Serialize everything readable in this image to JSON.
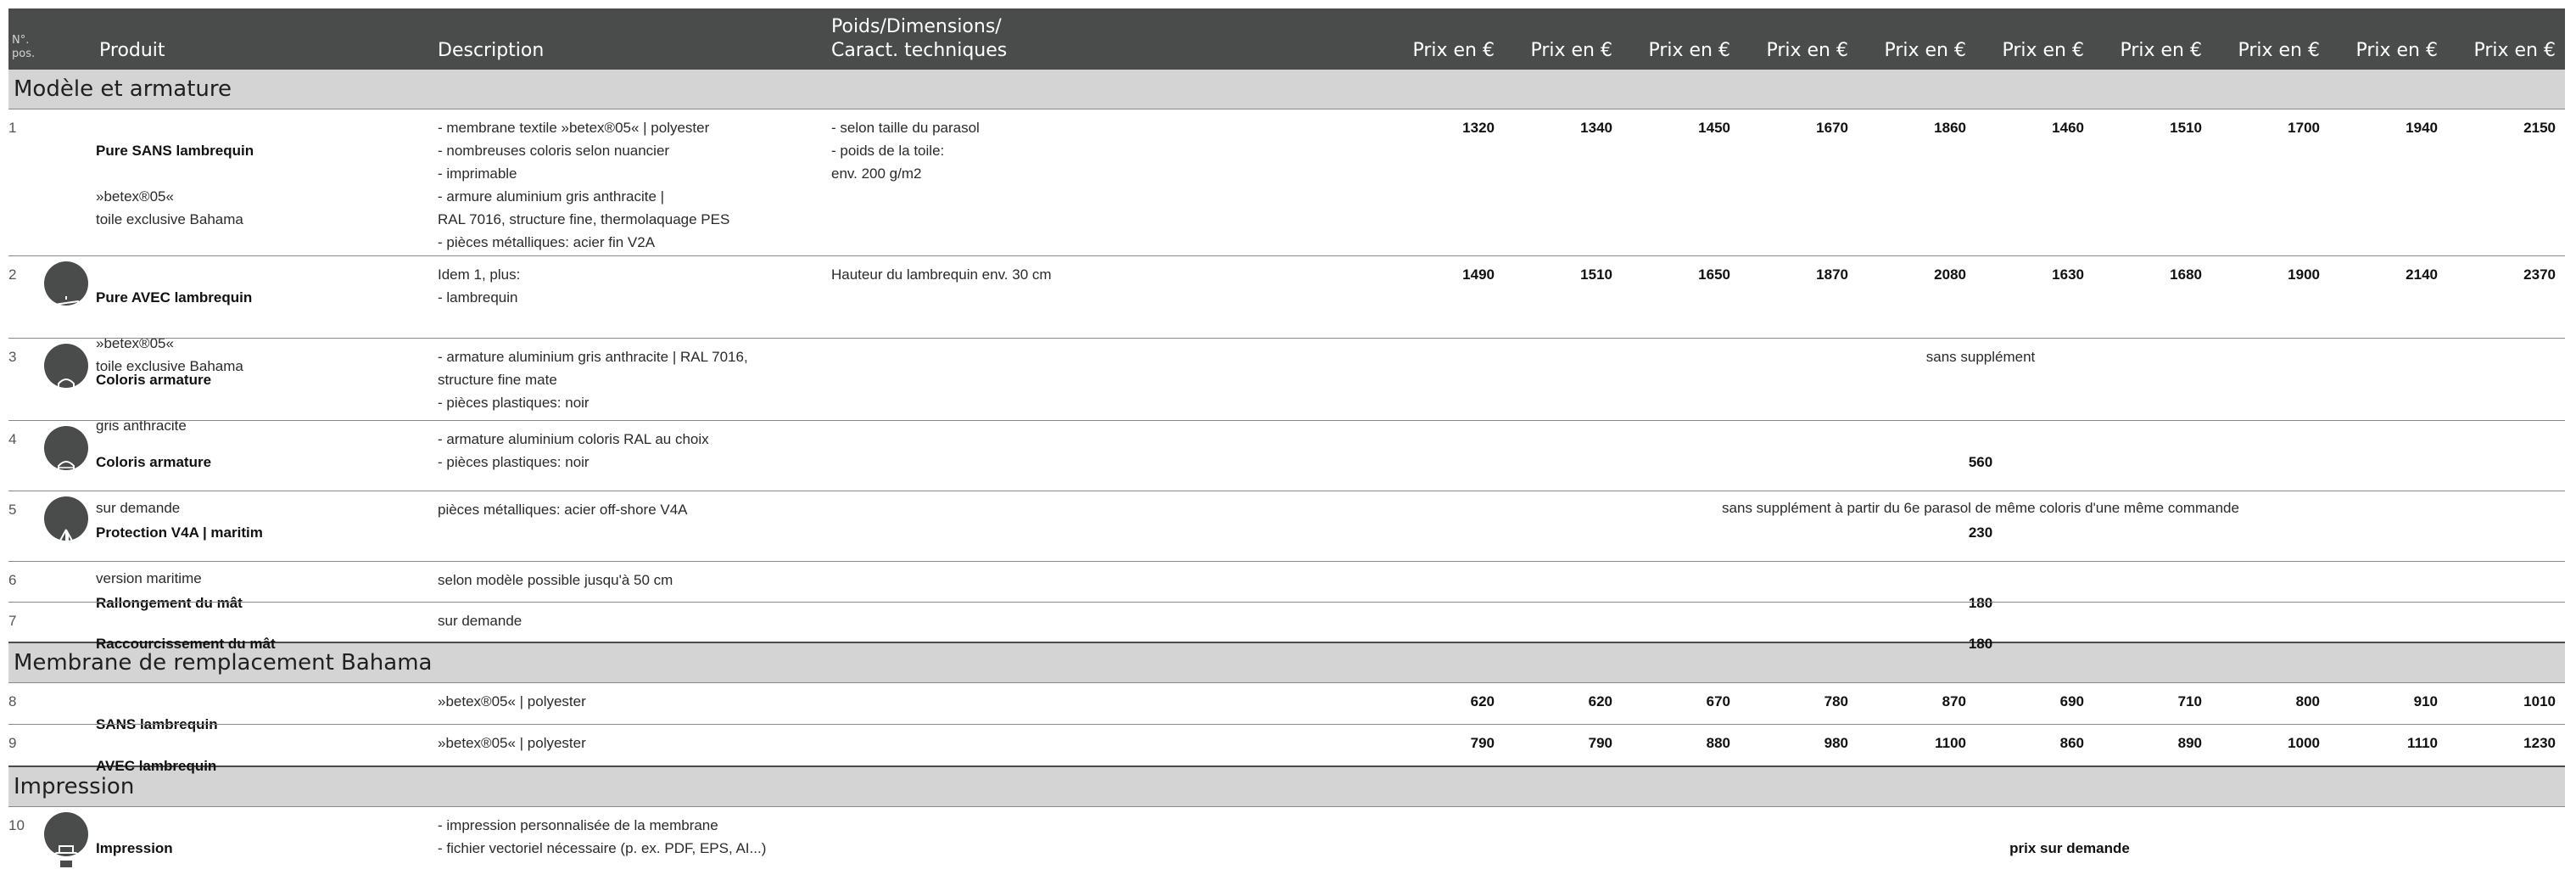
{
  "header": {
    "pos": "N°.\npos.",
    "produit": "Produit",
    "description": "Description",
    "poids": "Poids/Dimensions/\nCaract. techniques",
    "prices": [
      "Prix en €",
      "Prix en €",
      "Prix en €",
      "Prix en €",
      "Prix en €",
      "Prix en €",
      "Prix en €",
      "Prix en €",
      "Prix en €",
      "Prix en €"
    ]
  },
  "sections": {
    "modele": "Modèle et armature",
    "membrane": "Membrane de remplacement Bahama",
    "impression": "Impression"
  },
  "rows": [
    {
      "pos": "1",
      "icon": "",
      "name": "Pure SANS lambrequin",
      "sub": "»betex®05«\ntoile exclusive Bahama",
      "desc": "- membrane textile »betex®05« | polyester\n- nombreuses coloris selon nuancier\n- imprimable\n- armure aluminium gris anthracite |\n  RAL 7016, structure fine, thermolaquage PES\n- pièces métalliques: acier fin V2A",
      "poids": "- selon taille du parasol\n- poids de la toile:\n  env. 200 g/m2",
      "prices": [
        "1320",
        "1340",
        "1450",
        "1670",
        "1860",
        "1460",
        "1510",
        "1700",
        "1940",
        "2150"
      ]
    },
    {
      "pos": "2",
      "icon": "lambrequin-icon",
      "name": "Pure AVEC lambrequin",
      "sub": "»betex®05«\ntoile exclusive Bahama",
      "desc": "Idem 1, plus:\n- lambrequin",
      "poids": "Hauteur du lambrequin env. 30 cm",
      "prices": [
        "1490",
        "1510",
        "1650",
        "1870",
        "2080",
        "1630",
        "1680",
        "1900",
        "2140",
        "2370"
      ]
    },
    {
      "pos": "3",
      "icon": "frame-color-icon",
      "name": "Coloris armature",
      "sub": "gris anthracite",
      "desc": "- armature aluminium gris anthracite | RAL 7016,\n  structure fine mate\n- pièces plastiques: noir",
      "span": "sans supplément"
    },
    {
      "pos": "4",
      "icon": "frame-custom-color-icon",
      "name": "Coloris armature",
      "sub": "sur demande",
      "desc": "- armature aluminium coloris RAL au choix\n- pièces plastiques: noir",
      "span": "560",
      "span_note": "sans supplément à partir du 6e parasol de même coloris d'une même commande"
    },
    {
      "pos": "5",
      "icon": "sailboat-icon",
      "name": "Protection V4A | maritim",
      "sub": "version maritime",
      "desc": "pièces métalliques: acier off-shore V4A",
      "span": "230"
    },
    {
      "pos": "6",
      "name": "Rallongement du mât",
      "desc": "selon modèle possible jusqu'à 50 cm",
      "span": "180"
    },
    {
      "pos": "7",
      "name": "Raccourcissement du mât",
      "desc": "sur demande",
      "span": "180"
    },
    {
      "pos": "8",
      "name": "SANS lambrequin",
      "desc": "»betex®05« | polyester",
      "prices": [
        "620",
        "620",
        "670",
        "780",
        "870",
        "690",
        "710",
        "800",
        "910",
        "1010"
      ]
    },
    {
      "pos": "9",
      "name": "AVEC lambrequin",
      "desc": "»betex®05« | polyester",
      "prices": [
        "790",
        "790",
        "880",
        "980",
        "1100",
        "860",
        "890",
        "1000",
        "1110",
        "1230"
      ]
    },
    {
      "pos": "10",
      "icon": "printer-icon",
      "name": "Impression",
      "desc": "- impression personnalisée de la membrane\n- fichier vectoriel nécessaire (p. ex. PDF, EPS, AI...)",
      "span_bold": "prix sur demande"
    }
  ],
  "colors": {
    "header_bg": "#4a4b4b",
    "section_bg": "#d4d4d4",
    "row_rule": "#8a8a8a"
  }
}
